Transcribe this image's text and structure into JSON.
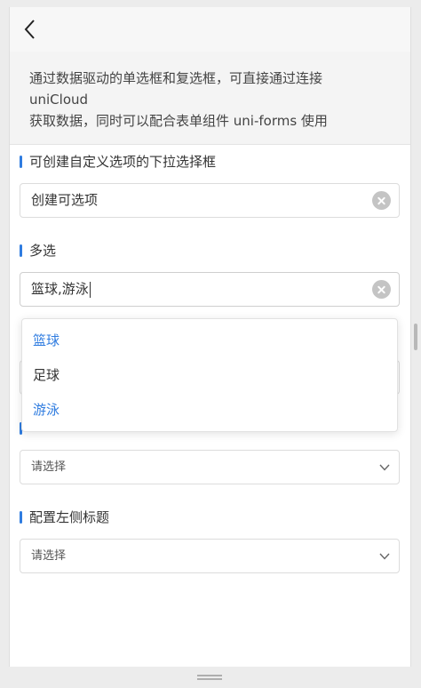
{
  "intro": {
    "line1": "通过数据驱动的单选框和复选框，可直接通过连接",
    "line2": "uniCloud",
    "line3": "获取数据，同时可以配合表单组件 uni-forms 使用"
  },
  "sections": [
    {
      "title": "可创建自定义选项的下拉选择框",
      "value": "创建可选项"
    },
    {
      "title": "多选",
      "value": "篮球,游泳"
    },
    {
      "title": "",
      "placeholder": "请选择"
    },
    {
      "title": "配置左侧标题",
      "placeholder": "请选择"
    }
  ],
  "dropdown": {
    "options": [
      {
        "label": "篮球",
        "selected": true
      },
      {
        "label": "足球",
        "selected": false
      },
      {
        "label": "游泳",
        "selected": true
      }
    ]
  },
  "colors": {
    "accent": "#2f7ce0",
    "border": "#dcdcdc"
  },
  "icons": {
    "back": "chevron-left-icon",
    "clear": "clear-icon",
    "dropdown": "chevron-down-icon"
  }
}
